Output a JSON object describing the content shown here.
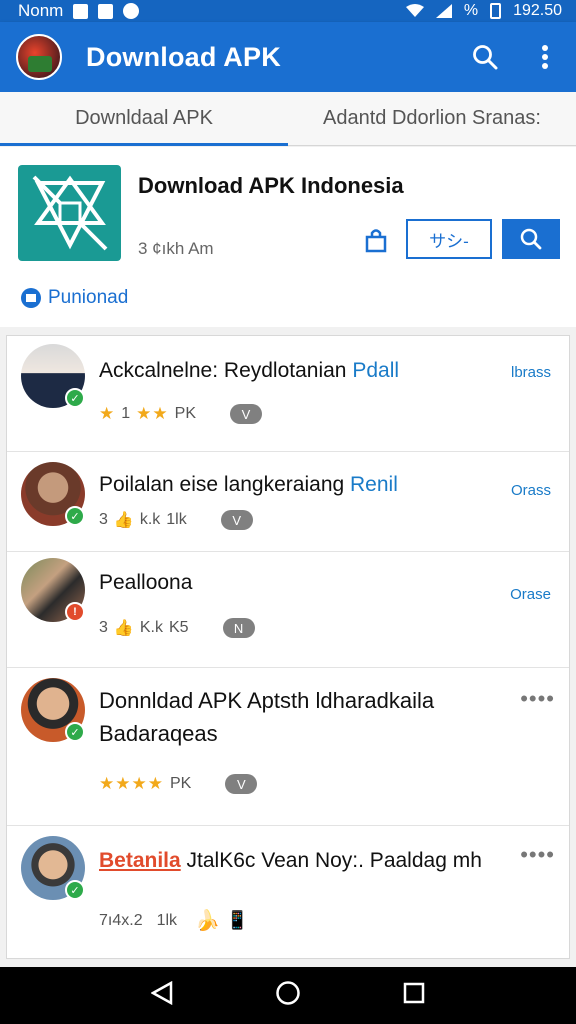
{
  "status_bar": {
    "carrier": "Nonm",
    "percent": "%",
    "time": "192.50"
  },
  "app_bar": {
    "title": "Download APK"
  },
  "tabs": [
    {
      "label": "Downldaal APK",
      "active": true
    },
    {
      "label": "Adantd Ddorlion Sranas:",
      "active": false
    }
  ],
  "header": {
    "app_name": "Download APK Indonesia",
    "meta": "3 ¢ıkh Am",
    "outline_button": "サシ-",
    "download_link": "Punionad"
  },
  "list": [
    {
      "title": "Ackcalnelne: Reydlotanian",
      "title_accent": "Pdall",
      "meta_rating": "★",
      "meta_text1": "1",
      "meta_stars": "★★",
      "meta_text2": "PK",
      "pill": "V",
      "side": "lbrass",
      "badge": "green"
    },
    {
      "title": "Poilalan eise langkeraiang",
      "title_accent": "Renil",
      "meta_text1": "3",
      "meta_thumb": "👍",
      "meta_text2": "k.k",
      "meta_text3": "1lk",
      "pill": "V",
      "side": "Orass",
      "badge": "green"
    },
    {
      "title": "Pealloona",
      "meta_text1": "3",
      "meta_thumb": "👍",
      "meta_text2": "K.k",
      "meta_text3": "K5",
      "pill": "N",
      "side": "Orase",
      "badge": "red"
    },
    {
      "title": "Donnldad APK Aptsth ldharadkaila Badaraqeas",
      "meta_stars": "★★★★",
      "meta_text2": "PK",
      "pill": "V",
      "more": "••••",
      "badge": "green"
    },
    {
      "title_red": "Betanila",
      "title": " JtalK6c Vean Noy:. Paaldag mh",
      "meta_text1": "7ı4x.2",
      "meta_text3": "1lk",
      "emoji1": "🍌",
      "emoji2": "📱",
      "more": "••••",
      "badge": "green"
    }
  ],
  "colors": {
    "primary": "#1a6fd1",
    "accent_text": "#1a7bc8",
    "star": "#f2a91b",
    "verified": "#2eaa4a",
    "alert": "#e14b2c"
  }
}
